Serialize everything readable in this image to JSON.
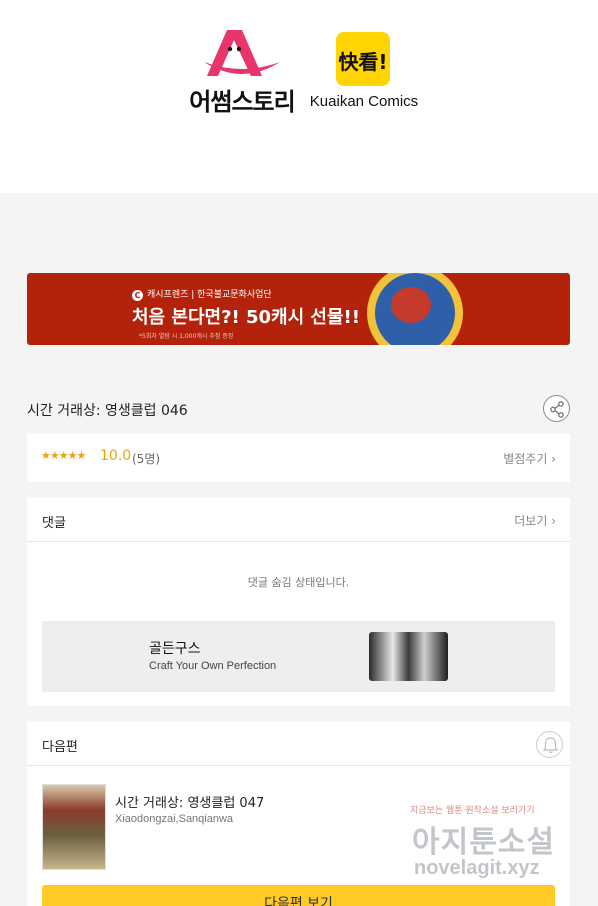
{
  "header": {
    "logo_awesome": "어썸스토리",
    "logo_kuaikan_mark": "快看!",
    "logo_kuaikan": "Kuaikan Comics"
  },
  "banner": {
    "brand_mark": "C",
    "line1": "캐시프렌즈 | 한국불교문화사업단",
    "line2": "처음 본다면?! 50캐시 선물!!",
    "note": "*5회차 열람 시 1,000캐시 추첨 증정"
  },
  "episode": {
    "title": "시간 거래상: 영생클럽 046"
  },
  "rating": {
    "stars": "★★★★★",
    "score": "10.0",
    "count": "(5명)",
    "rate_link": "별점주기 ›"
  },
  "comments": {
    "title": "댓글",
    "more": "더보기 ›",
    "hidden_message": "댓글 숨김 상태입니다."
  },
  "ad": {
    "title": "골든구스",
    "subtitle": "Craft Your Own Perfection"
  },
  "next": {
    "section_title": "다음편",
    "title": "시간 거래상: 영생클럽 047",
    "authors": "Xiaodongzai,Sanqianwa",
    "button": "다음편 보기"
  },
  "watermark": {
    "top": "지금보는 웹툰 원작소설 보러가기",
    "main": "아지툰소설",
    "url": "novelagit.xyz"
  },
  "colors": {
    "accent": "#ffc926",
    "rating": "#e8a317",
    "banner_bg": "#b3230b",
    "awesome_pink": "#e8356b"
  }
}
